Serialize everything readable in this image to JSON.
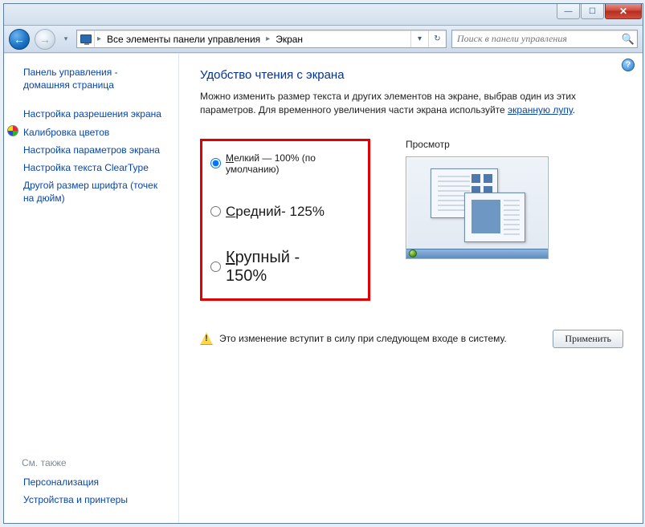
{
  "window": {
    "minimize_glyph": "—",
    "maximize_glyph": "☐",
    "close_glyph": "✕"
  },
  "nav": {
    "back_glyph": "←",
    "fwd_glyph": "→",
    "dropdown_glyph": "▾",
    "refresh_glyph": "↻"
  },
  "breadcrumb": {
    "level1": "Все элементы панели управления",
    "level2": "Экран",
    "sep": "▸"
  },
  "search": {
    "placeholder": "Поиск в панели управления",
    "icon_glyph": "🔍"
  },
  "help_glyph": "?",
  "sidebar": {
    "home": "Панель управления - домашняя страница",
    "links": [
      "Настройка разрешения экрана",
      "Калибровка цветов",
      "Настройка параметров экрана",
      "Настройка текста ClearType",
      "Другой размер шрифта (точек на дюйм)"
    ],
    "footer_header": "См. также",
    "footer_links": [
      "Персонализация",
      "Устройства и принтеры"
    ]
  },
  "main": {
    "title": "Удобство чтения с экрана",
    "desc_pre": "Можно изменить размер текста и других элементов на экране, выбрав один из этих параметров. Для временного увеличения части экрана используйте ",
    "desc_link": "экранную лупу",
    "desc_post": ".",
    "radio_small_pre": "М",
    "radio_small_post": "елкий — 100% (по умолчанию)",
    "radio_med_pre": "С",
    "radio_med_post": "редний- 125%",
    "radio_big_pre": "К",
    "radio_big_post": "рупный - 150%",
    "preview_label": "Просмотр",
    "notice": "Это изменение вступит в силу при следующем входе в систему.",
    "apply_label": "Применить"
  }
}
